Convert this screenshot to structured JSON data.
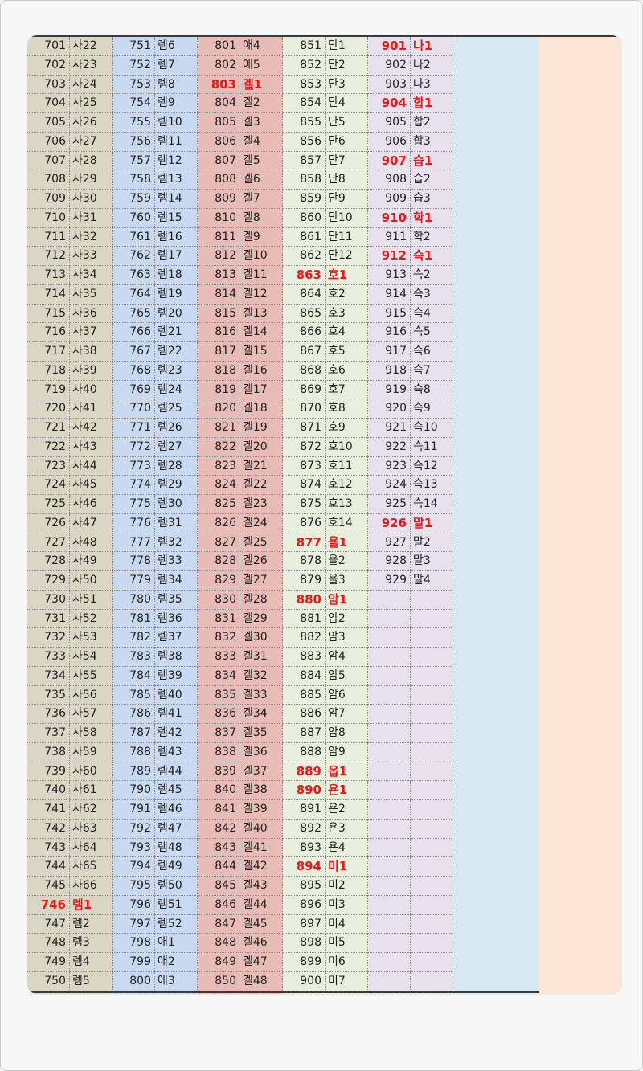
{
  "sheet": {
    "columns": [
      {
        "rows": [
          [
            "701",
            "사22"
          ],
          [
            "702",
            "사23"
          ],
          [
            "703",
            "사24"
          ],
          [
            "704",
            "사25"
          ],
          [
            "705",
            "사26"
          ],
          [
            "706",
            "사27"
          ],
          [
            "707",
            "사28"
          ],
          [
            "708",
            "사29"
          ],
          [
            "709",
            "사30"
          ],
          [
            "710",
            "사31"
          ],
          [
            "711",
            "사32"
          ],
          [
            "712",
            "사33"
          ],
          [
            "713",
            "사34"
          ],
          [
            "714",
            "사35"
          ],
          [
            "715",
            "사36"
          ],
          [
            "716",
            "사37"
          ],
          [
            "717",
            "사38"
          ],
          [
            "718",
            "사39"
          ],
          [
            "719",
            "사40"
          ],
          [
            "720",
            "사41"
          ],
          [
            "721",
            "사42"
          ],
          [
            "722",
            "사43"
          ],
          [
            "723",
            "사44"
          ],
          [
            "724",
            "사45"
          ],
          [
            "725",
            "사46"
          ],
          [
            "726",
            "사47"
          ],
          [
            "727",
            "사48"
          ],
          [
            "728",
            "사49"
          ],
          [
            "729",
            "사50"
          ],
          [
            "730",
            "사51"
          ],
          [
            "731",
            "사52"
          ],
          [
            "732",
            "사53"
          ],
          [
            "733",
            "사54"
          ],
          [
            "734",
            "사55"
          ],
          [
            "735",
            "사56"
          ],
          [
            "736",
            "사57"
          ],
          [
            "737",
            "사58"
          ],
          [
            "738",
            "사59"
          ],
          [
            "739",
            "사60"
          ],
          [
            "740",
            "사61"
          ],
          [
            "741",
            "사62"
          ],
          [
            "742",
            "사63"
          ],
          [
            "743",
            "사64"
          ],
          [
            "744",
            "사65"
          ],
          [
            "745",
            "사66"
          ],
          [
            "746",
            "렘1"
          ],
          [
            "747",
            "렘2"
          ],
          [
            "748",
            "렘3"
          ],
          [
            "749",
            "렘4"
          ],
          [
            "750",
            "렘5"
          ]
        ],
        "highlight": [
          "746"
        ]
      },
      {
        "rows": [
          [
            "751",
            "렘6"
          ],
          [
            "752",
            "렘7"
          ],
          [
            "753",
            "렘8"
          ],
          [
            "754",
            "렘9"
          ],
          [
            "755",
            "렘10"
          ],
          [
            "756",
            "렘11"
          ],
          [
            "757",
            "렘12"
          ],
          [
            "758",
            "렘13"
          ],
          [
            "759",
            "렘14"
          ],
          [
            "760",
            "렘15"
          ],
          [
            "761",
            "렘16"
          ],
          [
            "762",
            "렘17"
          ],
          [
            "763",
            "렘18"
          ],
          [
            "764",
            "렘19"
          ],
          [
            "765",
            "렘20"
          ],
          [
            "766",
            "렘21"
          ],
          [
            "767",
            "렘22"
          ],
          [
            "768",
            "렘23"
          ],
          [
            "769",
            "렘24"
          ],
          [
            "770",
            "렘25"
          ],
          [
            "771",
            "렘26"
          ],
          [
            "772",
            "렘27"
          ],
          [
            "773",
            "렘28"
          ],
          [
            "774",
            "렘29"
          ],
          [
            "775",
            "렘30"
          ],
          [
            "776",
            "렘31"
          ],
          [
            "777",
            "렘32"
          ],
          [
            "778",
            "렘33"
          ],
          [
            "779",
            "렘34"
          ],
          [
            "780",
            "렘35"
          ],
          [
            "781",
            "렘36"
          ],
          [
            "782",
            "렘37"
          ],
          [
            "783",
            "렘38"
          ],
          [
            "784",
            "렘39"
          ],
          [
            "785",
            "렘40"
          ],
          [
            "786",
            "렘41"
          ],
          [
            "787",
            "렘42"
          ],
          [
            "788",
            "렘43"
          ],
          [
            "789",
            "렘44"
          ],
          [
            "790",
            "렘45"
          ],
          [
            "791",
            "렘46"
          ],
          [
            "792",
            "렘47"
          ],
          [
            "793",
            "렘48"
          ],
          [
            "794",
            "렘49"
          ],
          [
            "795",
            "렘50"
          ],
          [
            "796",
            "렘51"
          ],
          [
            "797",
            "렘52"
          ],
          [
            "798",
            "애1"
          ],
          [
            "799",
            "애2"
          ],
          [
            "800",
            "애3"
          ]
        ],
        "highlight": []
      },
      {
        "rows": [
          [
            "801",
            "애4"
          ],
          [
            "802",
            "애5"
          ],
          [
            "803",
            "겔1"
          ],
          [
            "804",
            "겔2"
          ],
          [
            "805",
            "겔3"
          ],
          [
            "806",
            "겔4"
          ],
          [
            "807",
            "겔5"
          ],
          [
            "808",
            "겔6"
          ],
          [
            "809",
            "겔7"
          ],
          [
            "810",
            "겔8"
          ],
          [
            "811",
            "겔9"
          ],
          [
            "812",
            "겔10"
          ],
          [
            "813",
            "겔11"
          ],
          [
            "814",
            "겔12"
          ],
          [
            "815",
            "겔13"
          ],
          [
            "816",
            "겔14"
          ],
          [
            "817",
            "겔15"
          ],
          [
            "818",
            "겔16"
          ],
          [
            "819",
            "겔17"
          ],
          [
            "820",
            "겔18"
          ],
          [
            "821",
            "겔19"
          ],
          [
            "822",
            "겔20"
          ],
          [
            "823",
            "겔21"
          ],
          [
            "824",
            "겔22"
          ],
          [
            "825",
            "겔23"
          ],
          [
            "826",
            "겔24"
          ],
          [
            "827",
            "겔25"
          ],
          [
            "828",
            "겔26"
          ],
          [
            "829",
            "겔27"
          ],
          [
            "830",
            "겔28"
          ],
          [
            "831",
            "겔29"
          ],
          [
            "832",
            "겔30"
          ],
          [
            "833",
            "겔31"
          ],
          [
            "834",
            "겔32"
          ],
          [
            "835",
            "겔33"
          ],
          [
            "836",
            "겔34"
          ],
          [
            "837",
            "겔35"
          ],
          [
            "838",
            "겔36"
          ],
          [
            "839",
            "겔37"
          ],
          [
            "840",
            "겔38"
          ],
          [
            "841",
            "겔39"
          ],
          [
            "842",
            "겔40"
          ],
          [
            "843",
            "겔41"
          ],
          [
            "844",
            "겔42"
          ],
          [
            "845",
            "겔43"
          ],
          [
            "846",
            "겔44"
          ],
          [
            "847",
            "겔45"
          ],
          [
            "848",
            "겔46"
          ],
          [
            "849",
            "겔47"
          ],
          [
            "850",
            "겔48"
          ]
        ],
        "highlight": [
          "803"
        ]
      },
      {
        "rows": [
          [
            "851",
            "단1"
          ],
          [
            "852",
            "단2"
          ],
          [
            "853",
            "단3"
          ],
          [
            "854",
            "단4"
          ],
          [
            "855",
            "단5"
          ],
          [
            "856",
            "단6"
          ],
          [
            "857",
            "단7"
          ],
          [
            "858",
            "단8"
          ],
          [
            "859",
            "단9"
          ],
          [
            "860",
            "단10"
          ],
          [
            "861",
            "단11"
          ],
          [
            "862",
            "단12"
          ],
          [
            "863",
            "호1"
          ],
          [
            "864",
            "호2"
          ],
          [
            "865",
            "호3"
          ],
          [
            "866",
            "호4"
          ],
          [
            "867",
            "호5"
          ],
          [
            "868",
            "호6"
          ],
          [
            "869",
            "호7"
          ],
          [
            "870",
            "호8"
          ],
          [
            "871",
            "호9"
          ],
          [
            "872",
            "호10"
          ],
          [
            "873",
            "호11"
          ],
          [
            "874",
            "호12"
          ],
          [
            "875",
            "호13"
          ],
          [
            "876",
            "호14"
          ],
          [
            "877",
            "욜1"
          ],
          [
            "878",
            "욜2"
          ],
          [
            "879",
            "욜3"
          ],
          [
            "880",
            "암1"
          ],
          [
            "881",
            "암2"
          ],
          [
            "882",
            "암3"
          ],
          [
            "883",
            "암4"
          ],
          [
            "884",
            "암5"
          ],
          [
            "885",
            "암6"
          ],
          [
            "886",
            "암7"
          ],
          [
            "887",
            "암8"
          ],
          [
            "888",
            "암9"
          ],
          [
            "889",
            "옵1"
          ],
          [
            "890",
            "욘1"
          ],
          [
            "891",
            "욘2"
          ],
          [
            "892",
            "욘3"
          ],
          [
            "893",
            "욘4"
          ],
          [
            "894",
            "미1"
          ],
          [
            "895",
            "미2"
          ],
          [
            "896",
            "미3"
          ],
          [
            "897",
            "미4"
          ],
          [
            "898",
            "미5"
          ],
          [
            "899",
            "미6"
          ],
          [
            "900",
            "미7"
          ]
        ],
        "highlight": [
          "863",
          "877",
          "880",
          "889",
          "890",
          "894"
        ]
      },
      {
        "rows": [
          [
            "901",
            "나1"
          ],
          [
            "902",
            "나2"
          ],
          [
            "903",
            "나3"
          ],
          [
            "904",
            "합1"
          ],
          [
            "905",
            "합2"
          ],
          [
            "906",
            "합3"
          ],
          [
            "907",
            "습1"
          ],
          [
            "908",
            "습2"
          ],
          [
            "909",
            "습3"
          ],
          [
            "910",
            "학1"
          ],
          [
            "911",
            "학2"
          ],
          [
            "912",
            "슥1"
          ],
          [
            "913",
            "슥2"
          ],
          [
            "914",
            "슥3"
          ],
          [
            "915",
            "슥4"
          ],
          [
            "916",
            "슥5"
          ],
          [
            "917",
            "슥6"
          ],
          [
            "918",
            "슥7"
          ],
          [
            "919",
            "슥8"
          ],
          [
            "920",
            "슥9"
          ],
          [
            "921",
            "슥10"
          ],
          [
            "922",
            "슥11"
          ],
          [
            "923",
            "슥12"
          ],
          [
            "924",
            "슥13"
          ],
          [
            "925",
            "슥14"
          ],
          [
            "926",
            "말1"
          ],
          [
            "927",
            "말2"
          ],
          [
            "928",
            "말3"
          ],
          [
            "929",
            "말4"
          ],
          [
            "",
            ""
          ],
          [
            "",
            ""
          ],
          [
            "",
            ""
          ],
          [
            "",
            ""
          ],
          [
            "",
            ""
          ],
          [
            "",
            ""
          ],
          [
            "",
            ""
          ],
          [
            "",
            ""
          ],
          [
            "",
            ""
          ],
          [
            "",
            ""
          ],
          [
            "",
            ""
          ],
          [
            "",
            ""
          ],
          [
            "",
            ""
          ],
          [
            "",
            ""
          ],
          [
            "",
            ""
          ],
          [
            "",
            ""
          ],
          [
            "",
            ""
          ],
          [
            "",
            ""
          ],
          [
            "",
            ""
          ],
          [
            "",
            ""
          ],
          [
            "",
            ""
          ]
        ],
        "highlight": [
          "901",
          "904",
          "907",
          "910",
          "912",
          "926"
        ]
      }
    ]
  }
}
